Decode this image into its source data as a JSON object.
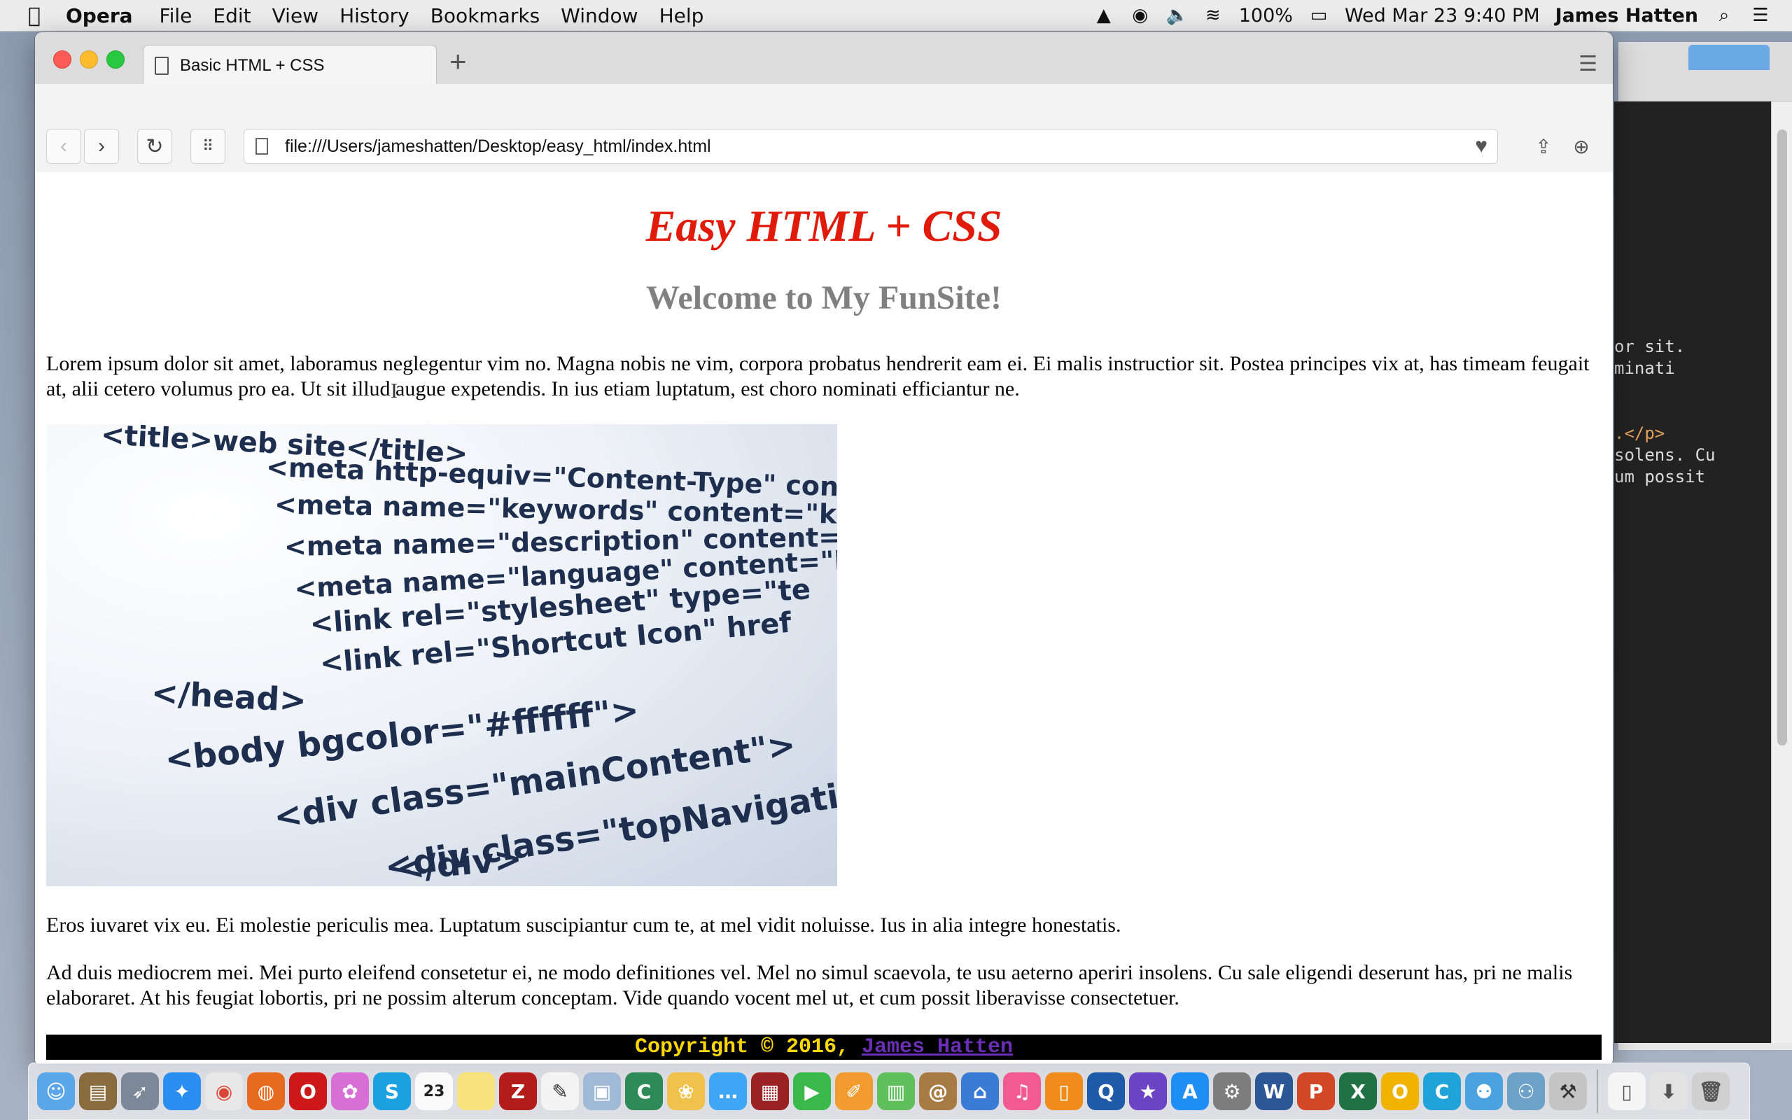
{
  "menubar": {
    "apple": "",
    "app_name": "Opera",
    "items": [
      "File",
      "Edit",
      "View",
      "History",
      "Bookmarks",
      "Window",
      "Help"
    ],
    "battery": "100%",
    "datetime": "Wed Mar 23  9:40 PM",
    "user": "James Hatten"
  },
  "browser": {
    "tab_title": "Basic HTML + CSS",
    "new_tab": "+",
    "url": "file:///Users/jameshatten/Desktop/easy_html/index.html"
  },
  "page": {
    "title": "Easy HTML + CSS",
    "subtitle": "Welcome to My FunSite!",
    "paragraph1": "Lorem ipsum dolor sit amet, laboramus neglegentur vim no. Magna nobis ne vim, corpora probatus hendrerit eam ei. Ei malis instructior sit. Postea principes vix at, has timeam feugait at, alii cetero volumus pro ea. Ut sit illud augue expetendis. In ius etiam luptatum, est choro nominati efficiantur ne.",
    "image_lines": [
      "<title>web site</title>",
      "<meta http-equiv=\"Content-Type\" conte",
      "<meta name=\"keywords\" content=\"key",
      "<meta name=\"description\" content=\"",
      "<meta name=\"language\" content=\"Ei",
      "<link rel=\"stylesheet\" type=\"te",
      "<link rel=\"Shortcut Icon\" href",
      "</head>",
      "<body bgcolor=\"#ffffff\">",
      "<div class=\"mainContent\">",
      "<div class=\"topNavigatio",
      "</div>"
    ],
    "paragraph2": "Eros iuvaret vix eu. Ei molestie periculis mea. Luptatum suscipiantur cum te, at mel vidit noluisse. Ius in alia integre honestatis.",
    "paragraph3": "Ad duis mediocrem mei. Mei purto eleifend consetetur ei, ne modo definitiones vel. Mel no simul scaevola, te usu aeterno aperiri insolens. Cu sale eligendi deserunt has, pri ne malis elaboraret. At his feugiat lobortis, pri ne possim alterum conceptam. Vide quando vocent mel ut, et cum possit liberavisse consectetuer.",
    "footer_text": "Copyright © 2016, ",
    "footer_link": "James Hatten"
  },
  "editor_snippet": [
    "or sit.",
    "minati",
    "",
    "",
    ".</p>",
    "solens. Cu",
    "um possit"
  ],
  "colors": {
    "title_red": "#e01b0b",
    "subtitle_gray": "#808080",
    "footer_bg": "#000000",
    "footer_text": "#ffd700",
    "footer_link": "#6a2fb5"
  },
  "dock_icons": [
    "finder-icon",
    "notes-icon",
    "launchpad-icon",
    "safari-icon",
    "chrome-icon",
    "firefox-icon",
    "opera-icon",
    "flower-icon",
    "skype-icon",
    "calendar-icon",
    "stickies-icon",
    "filezilla-icon",
    "textedit-icon",
    "preview-icon",
    "coda-icon",
    "photos-icon",
    "messages-icon",
    "photobooth-icon",
    "facetime-icon",
    "pages-icon",
    "numbers-icon",
    "contacts-icon",
    "keynote-icon",
    "itunes-icon",
    "ibooks-icon",
    "quicktime-icon",
    "imovie-icon",
    "appstore-icon",
    "system-preferences-icon",
    "word-icon",
    "powerpoint-icon",
    "excel-icon",
    "outlook-icon",
    "cryptocoin-icon",
    "lync-icon",
    "network-icon",
    "archive-icon",
    "document-icon",
    "downloads-icon",
    "trash-icon"
  ],
  "calendar_day": "23"
}
